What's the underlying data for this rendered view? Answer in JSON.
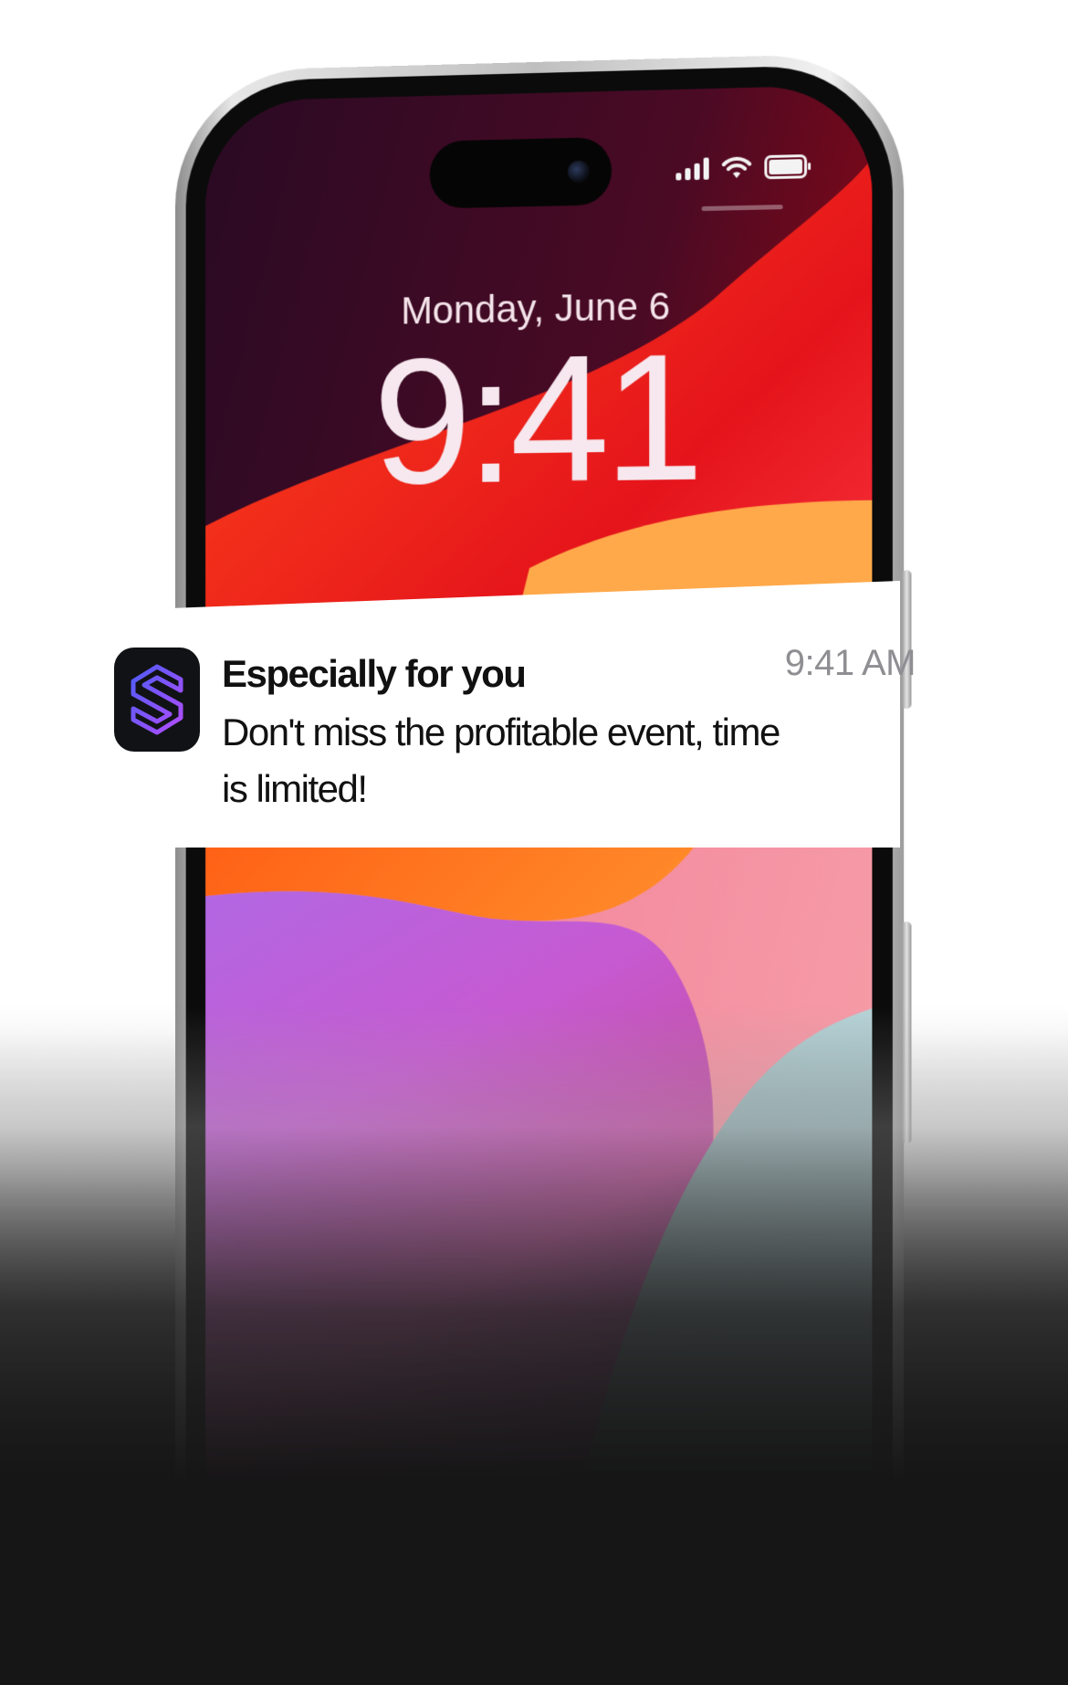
{
  "lockscreen": {
    "date": "Monday, June 6",
    "time": "9:41"
  },
  "status_bar": {
    "icons": [
      "signal-icon",
      "wifi-icon",
      "battery-icon"
    ]
  },
  "notification": {
    "app_icon": "app-logo-icon",
    "title": "Especially for you",
    "time": "9:41 AM",
    "message": "Don't miss the profitable event, time is limited!"
  },
  "colors": {
    "wallpaper_dark": "#2a0a24",
    "wallpaper_red": "#e5141b",
    "wallpaper_orange": "#ff7a1a",
    "wallpaper_purple": "#c75ad6",
    "wallpaper_pink": "#ec8aa8",
    "app_icon_bg": "#111216",
    "app_icon_gradient_start": "#4e5cf6",
    "app_icon_gradient_end": "#b34dff",
    "notification_time_color": "#8e8e93",
    "page_background_bottom": "#161616"
  }
}
